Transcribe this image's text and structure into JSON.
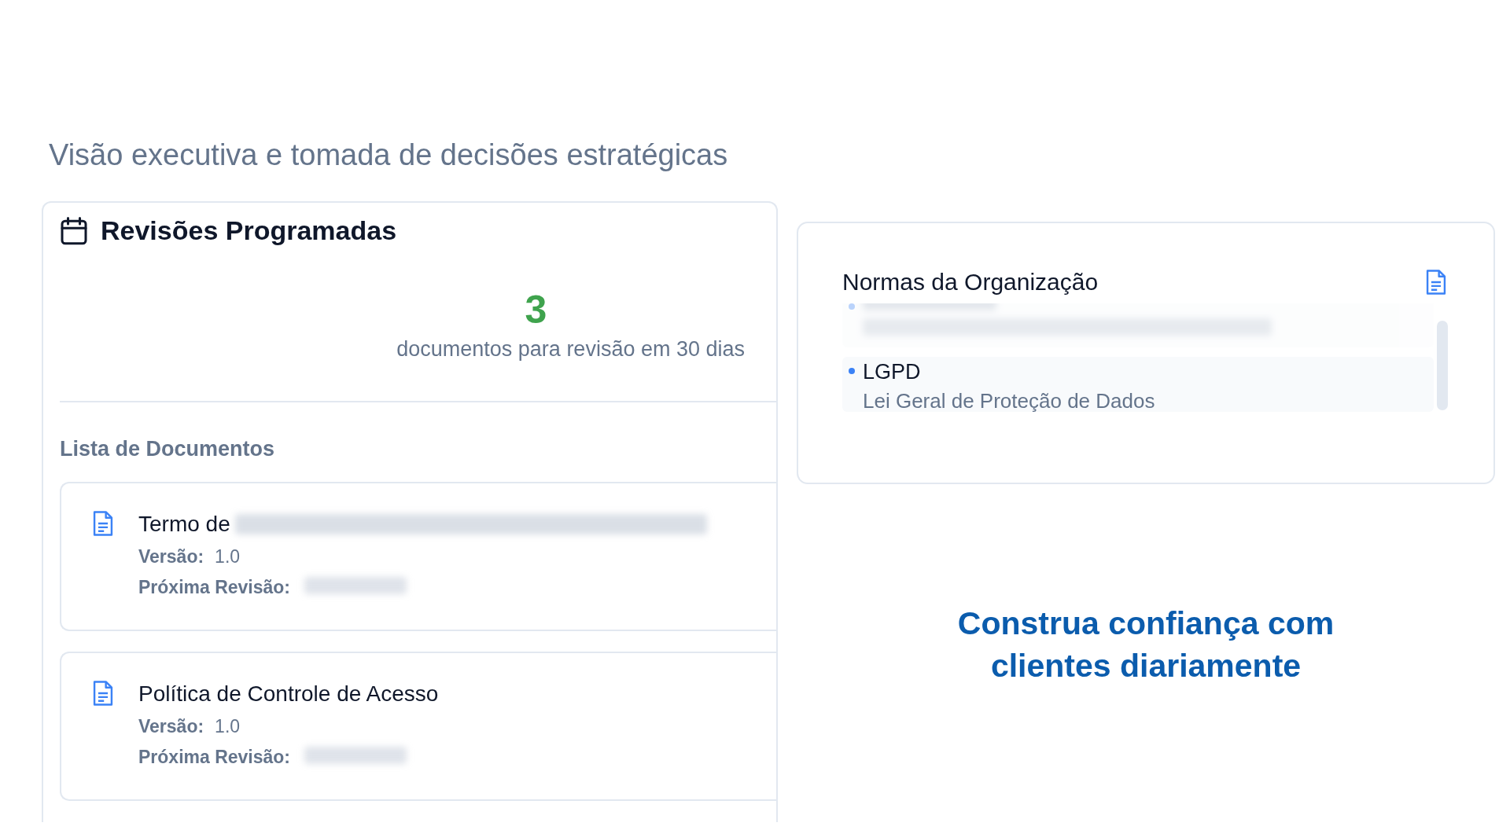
{
  "subtitle": "Visão executiva e tomada de decisões estratégicas",
  "scheduled_reviews": {
    "title": "Revisões Programadas",
    "count": "3",
    "count_caption": "documentos para revisão em 30 dias",
    "list_title": "Lista de Documentos",
    "documents": [
      {
        "title": "Termo de",
        "title_redacted": true,
        "version_label": "Versão:",
        "version": "1.0",
        "next_review_label": "Próxima Revisão:",
        "next_review_redacted": true
      },
      {
        "title": "Política de Controle de Acesso",
        "title_redacted": false,
        "version_label": "Versão:",
        "version": "1.0",
        "next_review_label": "Próxima Revisão:",
        "next_review_redacted": true
      }
    ]
  },
  "norms": {
    "title": "Normas da Organização",
    "items": [
      {
        "code_redacted": true,
        "faded": true
      },
      {
        "code": "LGPD",
        "name": "Lei Geral de Proteção de Dados",
        "faded": false
      }
    ]
  },
  "tagline": "Construa confiança com clientes diariamente"
}
